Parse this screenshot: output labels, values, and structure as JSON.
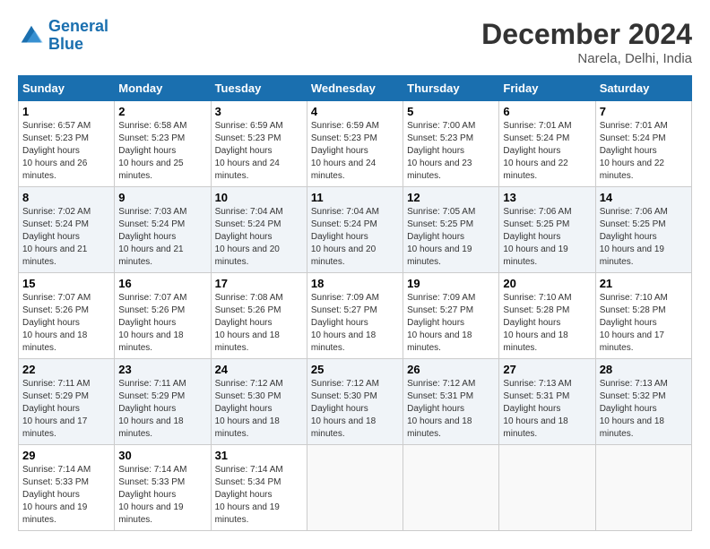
{
  "header": {
    "logo_line1": "General",
    "logo_line2": "Blue",
    "month": "December 2024",
    "location": "Narela, Delhi, India"
  },
  "weekdays": [
    "Sunday",
    "Monday",
    "Tuesday",
    "Wednesday",
    "Thursday",
    "Friday",
    "Saturday"
  ],
  "weeks": [
    [
      {
        "day": "1",
        "sunrise": "6:57 AM",
        "sunset": "5:23 PM",
        "daylight": "10 hours and 26 minutes."
      },
      {
        "day": "2",
        "sunrise": "6:58 AM",
        "sunset": "5:23 PM",
        "daylight": "10 hours and 25 minutes."
      },
      {
        "day": "3",
        "sunrise": "6:59 AM",
        "sunset": "5:23 PM",
        "daylight": "10 hours and 24 minutes."
      },
      {
        "day": "4",
        "sunrise": "6:59 AM",
        "sunset": "5:23 PM",
        "daylight": "10 hours and 24 minutes."
      },
      {
        "day": "5",
        "sunrise": "7:00 AM",
        "sunset": "5:23 PM",
        "daylight": "10 hours and 23 minutes."
      },
      {
        "day": "6",
        "sunrise": "7:01 AM",
        "sunset": "5:24 PM",
        "daylight": "10 hours and 22 minutes."
      },
      {
        "day": "7",
        "sunrise": "7:01 AM",
        "sunset": "5:24 PM",
        "daylight": "10 hours and 22 minutes."
      }
    ],
    [
      {
        "day": "8",
        "sunrise": "7:02 AM",
        "sunset": "5:24 PM",
        "daylight": "10 hours and 21 minutes."
      },
      {
        "day": "9",
        "sunrise": "7:03 AM",
        "sunset": "5:24 PM",
        "daylight": "10 hours and 21 minutes."
      },
      {
        "day": "10",
        "sunrise": "7:04 AM",
        "sunset": "5:24 PM",
        "daylight": "10 hours and 20 minutes."
      },
      {
        "day": "11",
        "sunrise": "7:04 AM",
        "sunset": "5:24 PM",
        "daylight": "10 hours and 20 minutes."
      },
      {
        "day": "12",
        "sunrise": "7:05 AM",
        "sunset": "5:25 PM",
        "daylight": "10 hours and 19 minutes."
      },
      {
        "day": "13",
        "sunrise": "7:06 AM",
        "sunset": "5:25 PM",
        "daylight": "10 hours and 19 minutes."
      },
      {
        "day": "14",
        "sunrise": "7:06 AM",
        "sunset": "5:25 PM",
        "daylight": "10 hours and 19 minutes."
      }
    ],
    [
      {
        "day": "15",
        "sunrise": "7:07 AM",
        "sunset": "5:26 PM",
        "daylight": "10 hours and 18 minutes."
      },
      {
        "day": "16",
        "sunrise": "7:07 AM",
        "sunset": "5:26 PM",
        "daylight": "10 hours and 18 minutes."
      },
      {
        "day": "17",
        "sunrise": "7:08 AM",
        "sunset": "5:26 PM",
        "daylight": "10 hours and 18 minutes."
      },
      {
        "day": "18",
        "sunrise": "7:09 AM",
        "sunset": "5:27 PM",
        "daylight": "10 hours and 18 minutes."
      },
      {
        "day": "19",
        "sunrise": "7:09 AM",
        "sunset": "5:27 PM",
        "daylight": "10 hours and 18 minutes."
      },
      {
        "day": "20",
        "sunrise": "7:10 AM",
        "sunset": "5:28 PM",
        "daylight": "10 hours and 18 minutes."
      },
      {
        "day": "21",
        "sunrise": "7:10 AM",
        "sunset": "5:28 PM",
        "daylight": "10 hours and 17 minutes."
      }
    ],
    [
      {
        "day": "22",
        "sunrise": "7:11 AM",
        "sunset": "5:29 PM",
        "daylight": "10 hours and 17 minutes."
      },
      {
        "day": "23",
        "sunrise": "7:11 AM",
        "sunset": "5:29 PM",
        "daylight": "10 hours and 18 minutes."
      },
      {
        "day": "24",
        "sunrise": "7:12 AM",
        "sunset": "5:30 PM",
        "daylight": "10 hours and 18 minutes."
      },
      {
        "day": "25",
        "sunrise": "7:12 AM",
        "sunset": "5:30 PM",
        "daylight": "10 hours and 18 minutes."
      },
      {
        "day": "26",
        "sunrise": "7:12 AM",
        "sunset": "5:31 PM",
        "daylight": "10 hours and 18 minutes."
      },
      {
        "day": "27",
        "sunrise": "7:13 AM",
        "sunset": "5:31 PM",
        "daylight": "10 hours and 18 minutes."
      },
      {
        "day": "28",
        "sunrise": "7:13 AM",
        "sunset": "5:32 PM",
        "daylight": "10 hours and 18 minutes."
      }
    ],
    [
      {
        "day": "29",
        "sunrise": "7:14 AM",
        "sunset": "5:33 PM",
        "daylight": "10 hours and 19 minutes."
      },
      {
        "day": "30",
        "sunrise": "7:14 AM",
        "sunset": "5:33 PM",
        "daylight": "10 hours and 19 minutes."
      },
      {
        "day": "31",
        "sunrise": "7:14 AM",
        "sunset": "5:34 PM",
        "daylight": "10 hours and 19 minutes."
      },
      null,
      null,
      null,
      null
    ]
  ]
}
